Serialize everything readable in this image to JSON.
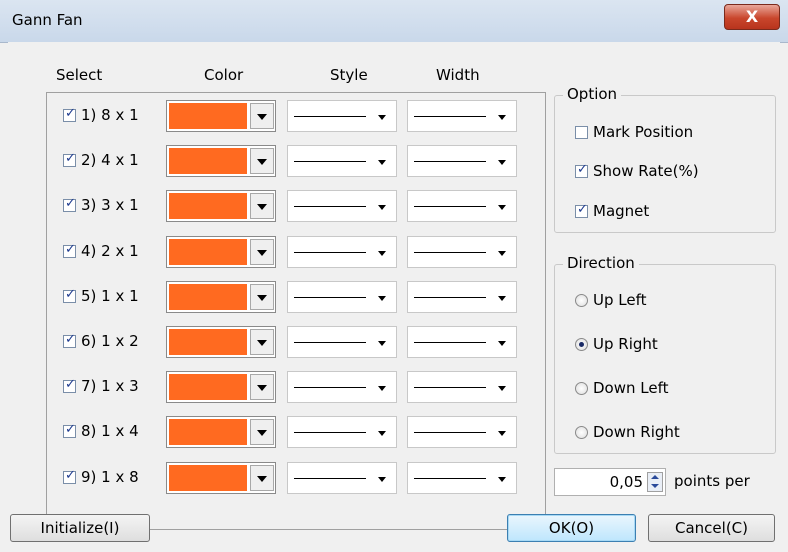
{
  "window": {
    "title": "Gann Fan",
    "close_label": "X"
  },
  "headers": {
    "select": "Select",
    "color": "Color",
    "style": "Style",
    "width": "Width"
  },
  "rows": [
    {
      "label": "1) 8 x 1",
      "checked": true,
      "color": "#ff6a20"
    },
    {
      "label": "2) 4 x 1",
      "checked": true,
      "color": "#ff6a20"
    },
    {
      "label": "3) 3 x 1",
      "checked": true,
      "color": "#ff6a20"
    },
    {
      "label": "4) 2 x 1",
      "checked": true,
      "color": "#ff6a20"
    },
    {
      "label": "5) 1 x 1",
      "checked": true,
      "color": "#ff6a20"
    },
    {
      "label": "6) 1 x 2",
      "checked": true,
      "color": "#ff6a20"
    },
    {
      "label": "7) 1 x 3",
      "checked": true,
      "color": "#ff6a20"
    },
    {
      "label": "8) 1 x 4",
      "checked": true,
      "color": "#ff6a20"
    },
    {
      "label": "9) 1 x 8",
      "checked": true,
      "color": "#ff6a20"
    }
  ],
  "option": {
    "title": "Option",
    "mark_position": {
      "label": "Mark Position",
      "checked": false
    },
    "show_rate": {
      "label": "Show Rate(%)",
      "checked": true
    },
    "magnet": {
      "label": "Magnet",
      "checked": true
    }
  },
  "direction": {
    "title": "Direction",
    "options": [
      {
        "label": "Up Left",
        "selected": false
      },
      {
        "label": "Up Right",
        "selected": true
      },
      {
        "label": "Down Left",
        "selected": false
      },
      {
        "label": "Down Right",
        "selected": false
      }
    ]
  },
  "points": {
    "value": "0,05",
    "label": "points per"
  },
  "buttons": {
    "initialize": "Initialize(I)",
    "ok": "OK(O)",
    "cancel": "Cancel(C)"
  }
}
